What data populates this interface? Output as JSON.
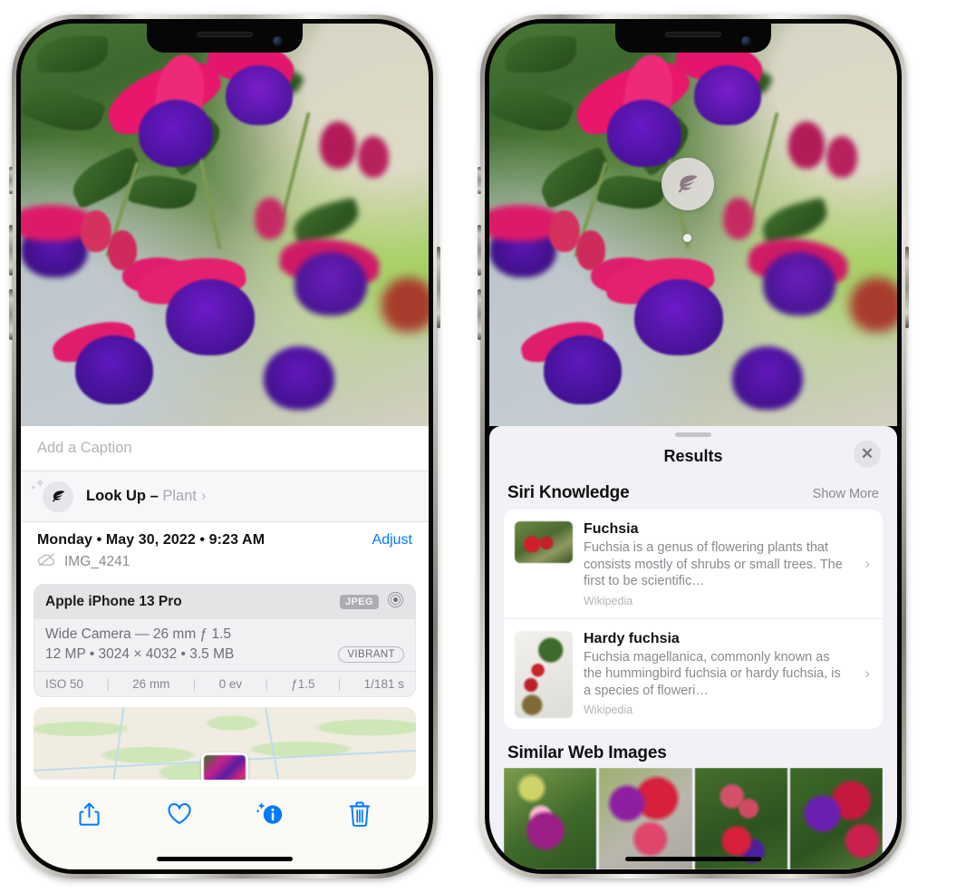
{
  "left_phone": {
    "caption_placeholder": "Add a Caption",
    "lookup": {
      "icon": "leaf-icon",
      "label": "Look Up – ",
      "subject": "Plant",
      "chevron": "›"
    },
    "metadata": {
      "date": "Monday • May 30, 2022 • 9:23 AM",
      "adjust_label": "Adjust",
      "filename": "IMG_4241",
      "cloud_icon": "icloud-slash-icon"
    },
    "exif": {
      "model": "Apple iPhone 13 Pro",
      "format_badge": "JPEG",
      "lens_icon": "aperture-icon",
      "lens_line": "Wide Camera — 26 mm ƒ 1.5",
      "dimensions_line": "12 MP • 3024 × 4032 • 3.5 MB",
      "style_badge": "VIBRANT",
      "stats": [
        "ISO 50",
        "26 mm",
        "0 ev",
        "ƒ1.5",
        "1/181 s"
      ]
    },
    "toolbar": [
      {
        "name": "share-icon",
        "glyph": "share"
      },
      {
        "name": "favorite-icon",
        "glyph": "heart"
      },
      {
        "name": "info-icon",
        "glyph": "info"
      },
      {
        "name": "delete-icon",
        "glyph": "trash"
      }
    ]
  },
  "right_phone": {
    "badge": {
      "icon": "leaf-icon"
    },
    "sheet_title": "Results",
    "close_label": "✕",
    "siri_knowledge": {
      "heading": "Siri Knowledge",
      "show_more": "Show More",
      "results": [
        {
          "title": "Fuchsia",
          "description": "Fuchsia is a genus of flowering plants that consists mostly of shrubs or small trees. The first to be scientific…",
          "source": "Wikipedia"
        },
        {
          "title": "Hardy fuchsia",
          "description": "Fuchsia magellanica, commonly known as the hummingbird fuchsia or hardy fuchsia, is a species of floweri…",
          "source": "Wikipedia"
        }
      ]
    },
    "similar_web_images": {
      "heading": "Similar Web Images",
      "count": 4
    }
  },
  "colors": {
    "accent_blue": "#007AFF",
    "sheet_bg": "#F2F1F6",
    "card_bg": "#FFFFFF",
    "exif_bg": "#F1F1F3",
    "secondary_text": "#8A8A90"
  }
}
